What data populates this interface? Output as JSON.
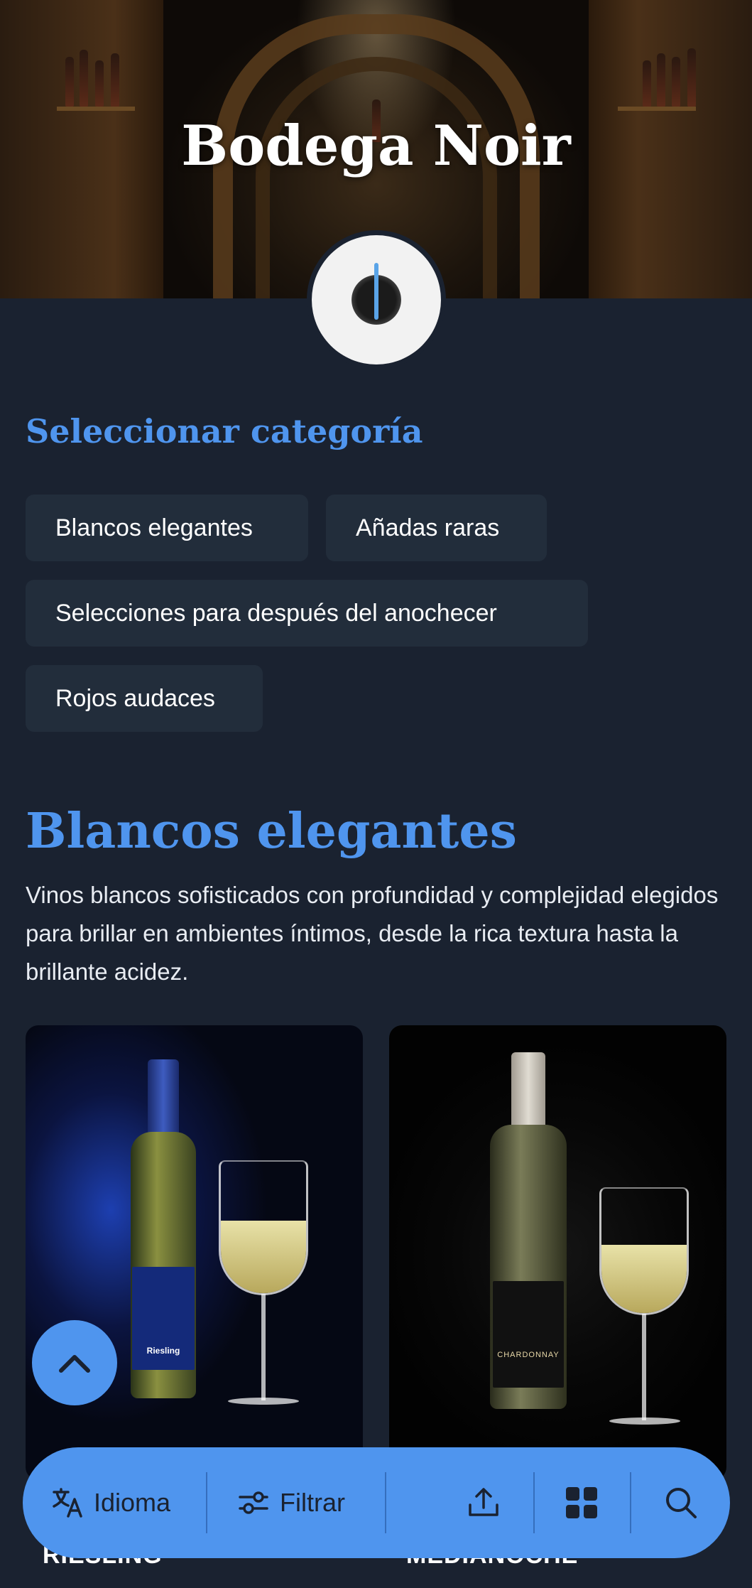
{
  "hero": {
    "title": "Bodega Noir"
  },
  "category_selector": {
    "heading": "Seleccionar categoría",
    "chips": [
      {
        "label": "Blancos elegantes"
      },
      {
        "label": "Añadas raras"
      },
      {
        "label": "Selecciones para después del anochecer"
      },
      {
        "label": "Rojos audaces"
      }
    ]
  },
  "category": {
    "title": "Blancos elegantes",
    "description": "Vinos blancos sofisticados con profundidad y complejidad elegidos para brillar en ambientes íntimos, desde la rica textura hasta la brillante acidez."
  },
  "products": [
    {
      "caption": "RIESLING",
      "bottle_label": "Riesling"
    },
    {
      "caption": "MEDIANOCHE",
      "bottle_label": "CHARDONNAY"
    }
  ],
  "bottom_bar": {
    "language_label": "Idioma",
    "filter_label": "Filtrar"
  },
  "colors": {
    "accent": "#4f95ee",
    "background": "#1a2230",
    "chip": "#222d3b"
  },
  "icons": [
    "translate-icon",
    "filter-icon",
    "share-icon",
    "grid-icon",
    "search-icon",
    "chevron-up-icon"
  ]
}
